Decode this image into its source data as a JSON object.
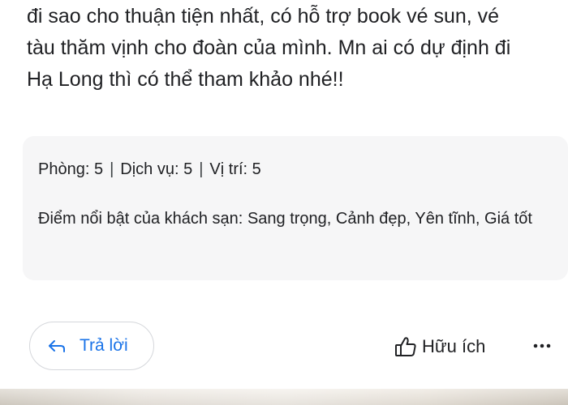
{
  "review": {
    "lines": [
      "đi sao cho thuận tiện nhất, có hỗ trợ book vé sun, vé",
      "tàu thăm vịnh cho đoàn của mình. Mn ai có dự định đi",
      "Hạ Long thì có thể tham khảo nhé!!"
    ]
  },
  "summary": {
    "ratings": [
      {
        "label": "Phòng:",
        "value": "5"
      },
      {
        "label": "Dịch vụ:",
        "value": "5"
      },
      {
        "label": "Vị trí:",
        "value": "5"
      }
    ],
    "separator": "|",
    "highlights_label": "Điểm nổi bật của khách sạn:",
    "highlights_value": "Sang trọng, Cảnh đẹp, Yên tĩnh, Giá tốt"
  },
  "actions": {
    "reply_label": "Trả lời",
    "reply_icon": "reply-arrow-icon",
    "helpful_label": "Hữu ích",
    "helpful_icon": "thumbs-up-icon",
    "more_icon": "more-horizontal-icon"
  },
  "colors": {
    "accent": "#1a73e8",
    "text": "#202124",
    "card_bg": "#f6f6f7"
  }
}
